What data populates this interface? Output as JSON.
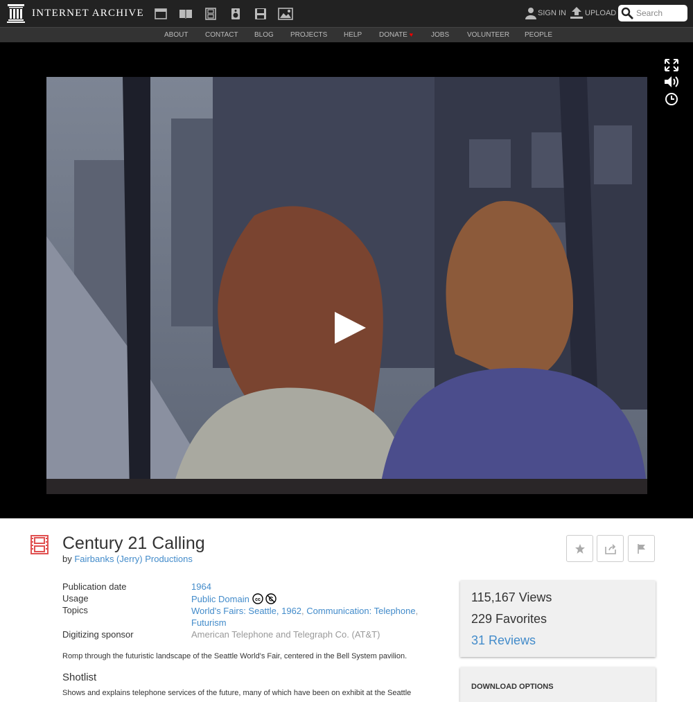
{
  "header": {
    "logo_text": "INTERNET ARCHIVE",
    "media_icons": [
      "web-icon",
      "texts-icon",
      "video-icon",
      "audio-icon",
      "software-icon",
      "images-icon"
    ],
    "sign_in": "SIGN IN",
    "upload": "UPLOAD",
    "search_placeholder": "Search"
  },
  "nav": {
    "items": [
      "ABOUT",
      "CONTACT",
      "BLOG",
      "PROJECTS",
      "HELP",
      "DONATE",
      "JOBS",
      "VOLUNTEER",
      "PEOPLE"
    ]
  },
  "player": {
    "controls": [
      "fullscreen-icon",
      "volume-icon",
      "clock-icon"
    ],
    "play_icon": "play-icon"
  },
  "item": {
    "title": "Century 21 Calling",
    "by_prefix": "by",
    "creator": "Fairbanks (Jerry) Productions",
    "metadata": {
      "publication_date_label": "Publication date",
      "publication_date": "1964",
      "usage_label": "Usage",
      "usage": "Public Domain",
      "topics_label": "Topics",
      "topics": [
        "World's Fairs: Seattle, 1962",
        "Communication: Telephone",
        "Futurism"
      ],
      "sponsor_label": "Digitizing sponsor",
      "sponsor": "American Telephone and Telegraph Co. (AT&T)"
    },
    "description": "Romp through the futuristic landscape of the Seattle World's Fair, centered in the Bell System pavilion.",
    "shotlist_heading": "Shotlist",
    "shotlist_text": "Shows and explains telephone services of the future, many of which have been on exhibit at the Seattle"
  },
  "stats": {
    "views": "115,167 Views",
    "favorites": "229 Favorites",
    "reviews": "31 Reviews"
  },
  "download": {
    "heading": "DOWNLOAD OPTIONS"
  },
  "colors": {
    "link": "#428bca",
    "topbar": "#222222",
    "film_icon": "#e05050"
  }
}
